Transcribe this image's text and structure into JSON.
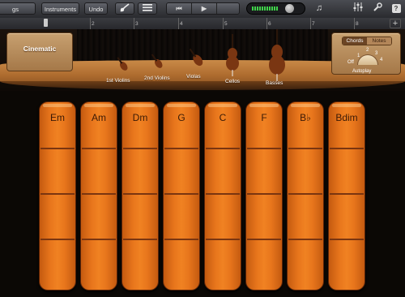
{
  "toolbar": {
    "songs_label": "gs",
    "instruments_label": "Instruments",
    "undo_label": "Undo"
  },
  "ruler": {
    "bars": [
      "2",
      "3",
      "4",
      "5",
      "6",
      "7",
      "8"
    ]
  },
  "preset": {
    "title": "Cinematic"
  },
  "instruments": [
    "1st Violins",
    "2nd Violins",
    "Violas",
    "Cellos",
    "Basses"
  ],
  "mode": {
    "chords_label": "Chords",
    "notes_label": "Notes",
    "selected": "Chords"
  },
  "autoplay": {
    "label": "Autoplay",
    "off_label": "Off",
    "positions": [
      "1",
      "2",
      "3",
      "4"
    ]
  },
  "chords": [
    "Em",
    "Am",
    "Dm",
    "G",
    "C",
    "F",
    "B♭",
    "Bdim"
  ],
  "colors": {
    "strip": "#e8761c",
    "floor": "#b06e30",
    "meter": "#3fd34a"
  }
}
